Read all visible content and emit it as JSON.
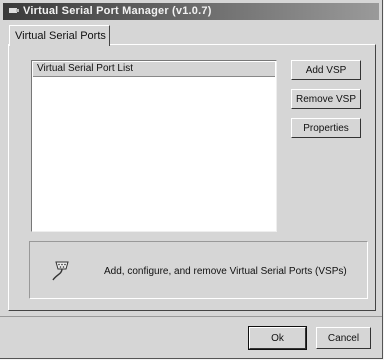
{
  "window": {
    "title": "Virtual Serial Port Manager (v1.0.7)"
  },
  "tabs": [
    {
      "label": "Virtual Serial Ports",
      "selected": true
    }
  ],
  "vsp_list": {
    "header": "Virtual Serial Port List",
    "items": []
  },
  "side_buttons": {
    "add": "Add VSP",
    "remove": "Remove VSP",
    "properties": "Properties"
  },
  "info": {
    "icon": "serial-connector-icon",
    "text": "Add, configure, and remove Virtual Serial Ports (VSPs)"
  },
  "footer_buttons": {
    "ok": "Ok",
    "cancel": "Cancel"
  }
}
